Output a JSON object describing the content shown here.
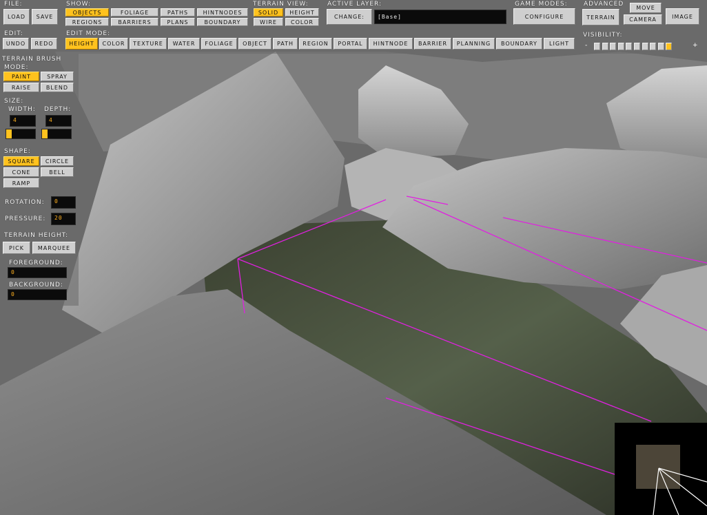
{
  "toolbar": {
    "file": {
      "label": "File:",
      "load": "Load",
      "save": "Save"
    },
    "show": {
      "label": "Show:",
      "objects": "Objects",
      "foliage": "Foliage",
      "paths": "Paths",
      "hintnodes": "HintNodes",
      "regions": "Regions",
      "barriers": "Barriers",
      "plans": "Plans",
      "boundary": "Boundary"
    },
    "terrain_view": {
      "label": "Terrain View:",
      "solid": "Solid",
      "height": "Height",
      "wire": "Wire",
      "color": "Color"
    },
    "active_layer": {
      "label": "Active Layer:",
      "change": "Change:",
      "value": "[Base]"
    },
    "game_modes": {
      "label": "Game Modes:",
      "configure": "Configure"
    },
    "advanced": {
      "label": "Advanced",
      "terrain": "Terrain",
      "move": "Move",
      "camera": "Camera",
      "image": "Image"
    },
    "edit": {
      "label": "Edit:",
      "undo": "Undo",
      "redo": "Redo"
    },
    "edit_mode": {
      "label": "Edit Mode:",
      "height": "Height",
      "color": "Color",
      "texture": "Texture",
      "water": "Water",
      "foliage": "Foliage",
      "object": "Object",
      "path": "Path",
      "region": "Region",
      "portal": "Portal",
      "hintnode": "HintNode",
      "barrier": "Barrier",
      "planning": "Planning",
      "boundary": "Boundary",
      "light": "Light"
    },
    "visibility": {
      "label": "Visibility:",
      "minus": "-",
      "plus": "+",
      "level": 10,
      "max": 10
    }
  },
  "brush": {
    "title": "Terrain Brush",
    "mode_label": "Mode:",
    "paint": "Paint",
    "spray": "Spray",
    "raise": "Raise",
    "blend": "Blend",
    "size_label": "Size:",
    "width_label": "Width:",
    "width_value": "4",
    "width_fill": 0.18,
    "depth_label": "Depth:",
    "depth_value": "4",
    "depth_fill": 0.18,
    "shape_label": "Shape:",
    "square": "Square",
    "circle": "Circle",
    "cone": "Cone",
    "bell": "Bell",
    "ramp": "Ramp",
    "rotation_label": "Rotation:",
    "rotation_value": "0",
    "pressure_label": "Pressure:",
    "pressure_value": "20",
    "height_label": "Terrain Height:",
    "pick": "Pick",
    "marquee": "Marquee",
    "foreground_label": "Foreground:",
    "foreground_value": "0",
    "background_label": "Background:",
    "background_value": "0"
  },
  "colors": {
    "accent": "#ffc21e",
    "selection": "#e020e0",
    "button": "#cfcfcf"
  }
}
